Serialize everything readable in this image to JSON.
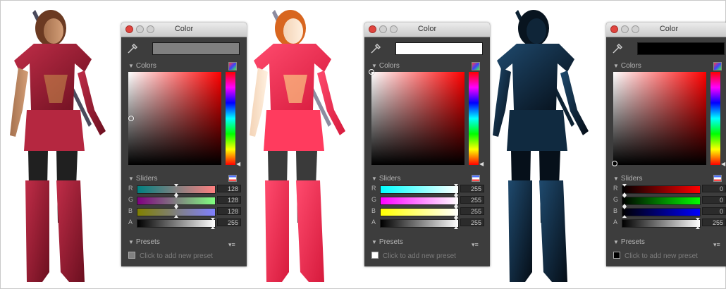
{
  "colors": {
    "window_bg": "#3d3d3d",
    "text": "#b4b4b4",
    "close": "#e0443e"
  },
  "panels": [
    {
      "title": "Color",
      "swatch": "#808080",
      "sections": {
        "colors": "Colors",
        "sliders": "Sliders",
        "presets": "Presets"
      },
      "sliders": [
        {
          "label": "R",
          "value": "128"
        },
        {
          "label": "G",
          "value": "128"
        },
        {
          "label": "B",
          "value": "128"
        },
        {
          "label": "A",
          "value": "255"
        }
      ],
      "add_preset": "Click to add new preset"
    },
    {
      "title": "Color",
      "swatch": "#ffffff",
      "sections": {
        "colors": "Colors",
        "sliders": "Sliders",
        "presets": "Presets"
      },
      "sliders": [
        {
          "label": "R",
          "value": "255"
        },
        {
          "label": "G",
          "value": "255"
        },
        {
          "label": "B",
          "value": "255"
        },
        {
          "label": "A",
          "value": "255"
        }
      ],
      "add_preset": "Click to add new preset"
    },
    {
      "title": "Color",
      "swatch": "#000000",
      "sections": {
        "colors": "Colors",
        "sliders": "Sliders",
        "presets": "Presets"
      },
      "sliders": [
        {
          "label": "R",
          "value": "0"
        },
        {
          "label": "G",
          "value": "0"
        },
        {
          "label": "B",
          "value": "0"
        },
        {
          "label": "A",
          "value": "255"
        }
      ],
      "add_preset": "Click to add new preset"
    }
  ],
  "icons": {
    "eyedropper": "eyedropper-icon",
    "menu": "preset-menu-icon"
  }
}
